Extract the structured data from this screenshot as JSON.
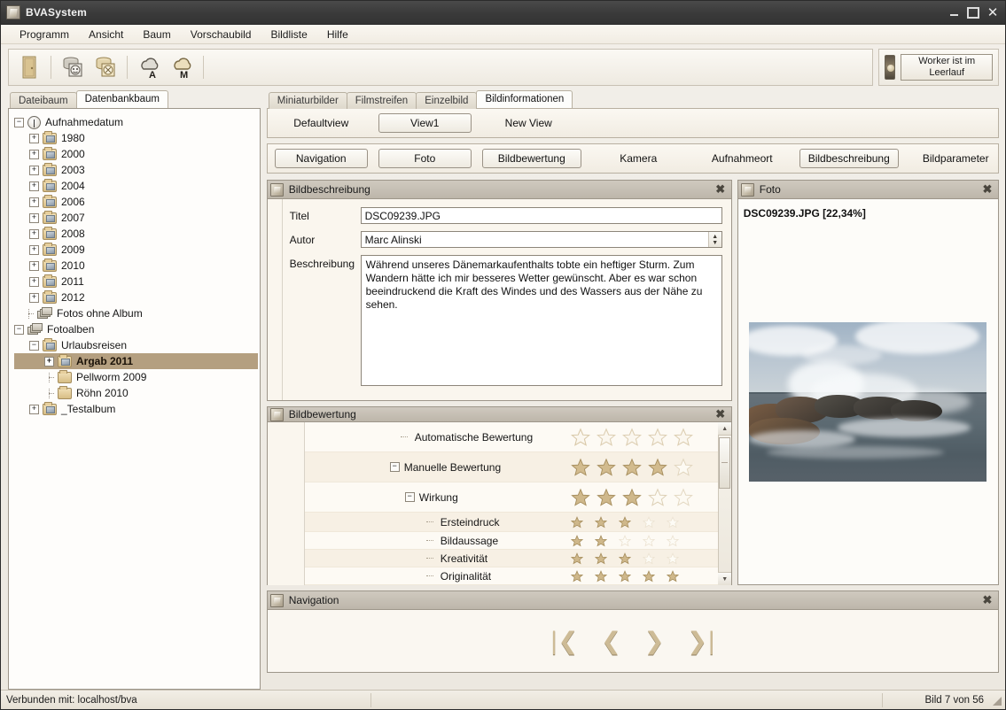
{
  "window": {
    "title": "BVASystem",
    "controls": {
      "minimize": "–",
      "maximize": "□",
      "close": "✕"
    }
  },
  "menu": {
    "items": [
      "Programm",
      "Ansicht",
      "Baum",
      "Vorschaubild",
      "Bildliste",
      "Hilfe"
    ]
  },
  "toolbar": {
    "buttons": [
      {
        "name": "exit-door-icon",
        "label": ""
      },
      {
        "name": "database-connect-icon",
        "label": ""
      },
      {
        "name": "database-disconnect-icon",
        "label": ""
      },
      {
        "name": "cloud-auto-icon",
        "label": ""
      },
      {
        "name": "cloud-manual-icon",
        "label": ""
      }
    ],
    "worker_status": "Worker ist im Leerlauf"
  },
  "sidebar": {
    "tabs": [
      {
        "label": "Dateibaum",
        "active": false
      },
      {
        "label": "Datenbankbaum",
        "active": true
      }
    ],
    "tree": [
      {
        "label": "Aufnahmedatum",
        "depth": 0,
        "expander": "-",
        "icon": "clock-icon"
      },
      {
        "label": "1980",
        "depth": 1,
        "expander": "+",
        "icon": "folder-image-icon"
      },
      {
        "label": "2000",
        "depth": 1,
        "expander": "+",
        "icon": "folder-image-icon"
      },
      {
        "label": "2003",
        "depth": 1,
        "expander": "+",
        "icon": "folder-image-icon"
      },
      {
        "label": "2004",
        "depth": 1,
        "expander": "+",
        "icon": "folder-image-icon"
      },
      {
        "label": "2006",
        "depth": 1,
        "expander": "+",
        "icon": "folder-image-icon"
      },
      {
        "label": "2007",
        "depth": 1,
        "expander": "+",
        "icon": "folder-image-icon"
      },
      {
        "label": "2008",
        "depth": 1,
        "expander": "+",
        "icon": "folder-image-icon"
      },
      {
        "label": "2009",
        "depth": 1,
        "expander": "+",
        "icon": "folder-image-icon"
      },
      {
        "label": "2010",
        "depth": 1,
        "expander": "+",
        "icon": "folder-image-icon"
      },
      {
        "label": "2011",
        "depth": 1,
        "expander": "+",
        "icon": "folder-image-icon"
      },
      {
        "label": "2012",
        "depth": 1,
        "expander": "+",
        "icon": "folder-image-icon"
      },
      {
        "label": "Fotos ohne Album",
        "depth": 1,
        "expander": "",
        "icon": "stack-icon"
      },
      {
        "label": "Fotoalben",
        "depth": 0,
        "expander": "-",
        "icon": "stack-icon"
      },
      {
        "label": "Urlaubsreisen",
        "depth": 1,
        "expander": "-",
        "icon": "folder-image-icon"
      },
      {
        "label": "Argab 2011",
        "depth": 2,
        "expander": "+",
        "icon": "folder-image-icon",
        "selected": true
      },
      {
        "label": "Pellworm 2009",
        "depth": 2,
        "expander": "",
        "icon": "folder-icon"
      },
      {
        "label": "Röhn 2010",
        "depth": 2,
        "expander": "",
        "icon": "folder-icon"
      },
      {
        "label": "_Testalbum",
        "depth": 1,
        "expander": "+",
        "icon": "folder-image-icon"
      }
    ]
  },
  "content": {
    "tabs": [
      {
        "label": "Miniaturbilder",
        "active": false
      },
      {
        "label": "Filmstreifen",
        "active": false
      },
      {
        "label": "Einzelbild",
        "active": false
      },
      {
        "label": "Bildinformationen",
        "active": true
      }
    ],
    "views": [
      {
        "label": "Defaultview",
        "framed": false
      },
      {
        "label": "View1",
        "framed": true
      },
      {
        "label": "New View",
        "framed": false
      }
    ],
    "sections": [
      {
        "label": "Navigation",
        "framed": true
      },
      {
        "label": "Foto",
        "framed": true
      },
      {
        "label": "Bildbewertung",
        "framed": true
      },
      {
        "label": "Kamera",
        "framed": false
      },
      {
        "label": "Aufnahmeort",
        "framed": false
      },
      {
        "label": "Bildbeschreibung",
        "framed": true
      },
      {
        "label": "Bildparameter",
        "framed": false
      }
    ]
  },
  "bildbeschreibung": {
    "title": "Bildbeschreibung",
    "close": "✖",
    "fields": {
      "titel_label": "Titel",
      "titel_value": "DSC09239.JPG",
      "autor_label": "Autor",
      "autor_value": "Marc Alinski",
      "beschreibung_label": "Beschreibung",
      "beschreibung_value": "Während unseres Dänemarkaufenthalts tobte ein heftiger Sturm. Zum Wandern hätte ich mir besseres Wetter gewünscht. Aber es war schon beeindruckend die Kraft des Windes und des Wassers aus der Nähe zu sehen."
    }
  },
  "bildbewertung": {
    "title": "Bildbewertung",
    "close": "✖",
    "max_stars": 5,
    "rows": [
      {
        "label": "Automatische Bewertung",
        "depth": 1,
        "expander": "",
        "filled": 0,
        "style": "outline-large"
      },
      {
        "label": "Manuelle Bewertung",
        "depth": 0,
        "expander": "-",
        "filled": 4,
        "style": "large"
      },
      {
        "label": "Wirkung",
        "depth": 1,
        "expander": "-",
        "filled": 3,
        "style": "large"
      },
      {
        "label": "Ersteindruck",
        "depth": 2,
        "expander": "",
        "filled": 3,
        "style": "small"
      },
      {
        "label": "Bildaussage",
        "depth": 2,
        "expander": "",
        "filled": 2,
        "style": "small"
      },
      {
        "label": "Kreativität",
        "depth": 2,
        "expander": "",
        "filled": 3,
        "style": "small"
      },
      {
        "label": "Originalität",
        "depth": 2,
        "expander": "",
        "filled": 5,
        "style": "small"
      }
    ],
    "scroll_up": "▲",
    "scroll_down": "▼"
  },
  "foto": {
    "title": "Foto",
    "close": "✖",
    "caption": "DSC09239.JPG [22,34%]",
    "image_alt": "Sturmwellen brechen sich an Felsen vor der Küste"
  },
  "navigation": {
    "title": "Navigation",
    "close": "✖",
    "buttons": [
      {
        "name": "nav-first",
        "glyph": "|❮"
      },
      {
        "name": "nav-previous",
        "glyph": "❮"
      },
      {
        "name": "nav-next",
        "glyph": "❯"
      },
      {
        "name": "nav-last",
        "glyph": "❯|"
      }
    ]
  },
  "statusbar": {
    "connection": "Verbunden mit: localhost/bva",
    "middle": "",
    "image_counter": "Bild 7 von 56"
  },
  "colors": {
    "selection": "#b49f80",
    "star": "#c3ab7e",
    "panel_title": "#c5bfb4",
    "titlebar": "#3a3a3a"
  }
}
